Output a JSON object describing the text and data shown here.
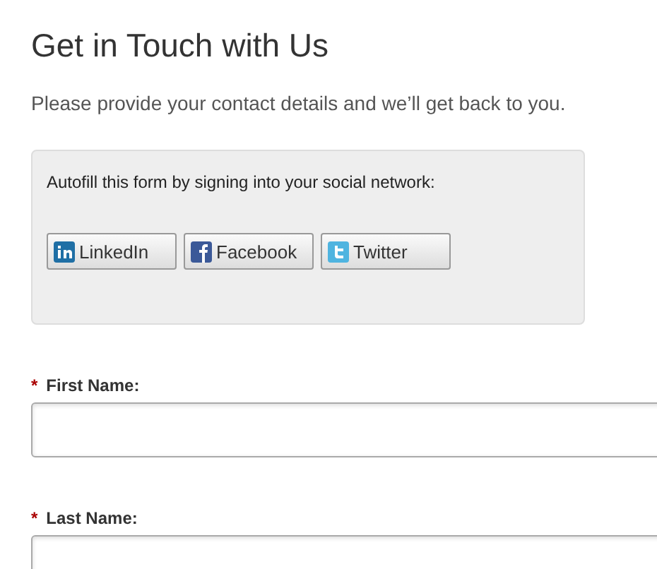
{
  "title": "Get in Touch with Us",
  "intro": "Please provide your contact details and we’ll get back to you.",
  "social": {
    "prompt": "Autofill this form by signing into your social network:",
    "buttons": [
      {
        "label": "LinkedIn",
        "kind": "linkedin"
      },
      {
        "label": "Facebook",
        "kind": "facebook"
      },
      {
        "label": "Twitter",
        "kind": "twitter"
      }
    ]
  },
  "fields": [
    {
      "label": "First Name:",
      "required": true,
      "required_mark": "*"
    },
    {
      "label": "Last Name:",
      "required": true,
      "required_mark": "*"
    }
  ]
}
